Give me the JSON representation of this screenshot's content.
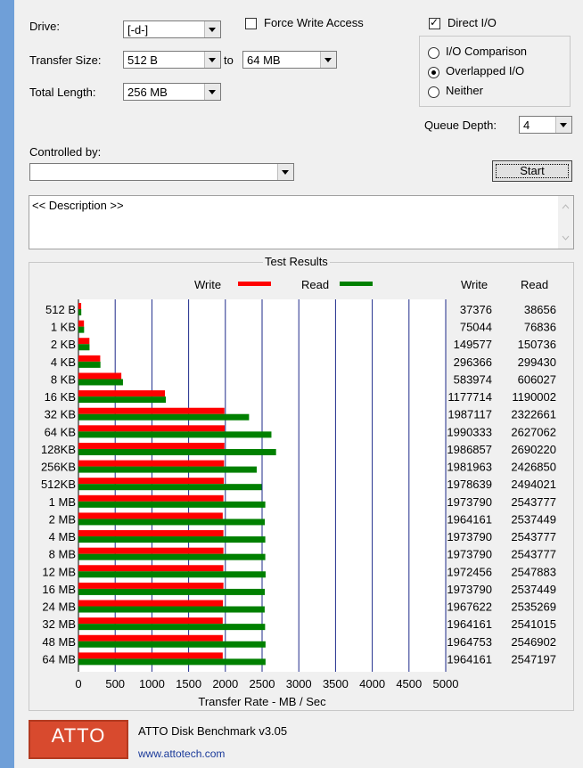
{
  "settings": {
    "drive_label": "Drive:",
    "drive_value": "[-d-]",
    "transfer_size_label": "Transfer Size:",
    "transfer_from": "512 B",
    "to_label": "to",
    "transfer_to": "64 MB",
    "total_length_label": "Total Length:",
    "total_length": "256 MB",
    "force_write_label": "Force Write Access",
    "force_write_checked": false,
    "direct_io_label": "Direct I/O",
    "direct_io_checked": true,
    "io_comparison_label": "I/O Comparison",
    "overlapped_label": "Overlapped I/O",
    "neither_label": "Neither",
    "selected_mode": "Overlapped I/O",
    "queue_depth_label": "Queue Depth:",
    "queue_depth": "4",
    "controlled_by_label": "Controlled by:",
    "controlled_by_value": "",
    "start_label": "Start",
    "description": "<< Description >>"
  },
  "results": {
    "title": "Test Results",
    "legend_write": "Write",
    "legend_read": "Read",
    "col_write": "Write",
    "col_read": "Read"
  },
  "footer": {
    "logo_text": "ATTO",
    "product": "ATTO Disk Benchmark v3.05",
    "url": "www.attotech.com"
  },
  "chart_data": {
    "type": "bar",
    "orientation": "horizontal",
    "categories": [
      "512 B",
      "1 KB",
      "2 KB",
      "4 KB",
      "8 KB",
      "16 KB",
      "32 KB",
      "64 KB",
      "128KB",
      "256KB",
      "512KB",
      "1 MB",
      "2 MB",
      "4 MB",
      "8 MB",
      "12 MB",
      "16 MB",
      "24 MB",
      "32 MB",
      "48 MB",
      "64 MB"
    ],
    "series": [
      {
        "name": "Write",
        "color": "#ff0000",
        "values": [
          37376,
          75044,
          149577,
          296366,
          583974,
          1177714,
          1987117,
          1990333,
          1986857,
          1981963,
          1978639,
          1973790,
          1964161,
          1973790,
          1973790,
          1972456,
          1973790,
          1967622,
          1964161,
          1964753,
          1964161
        ]
      },
      {
        "name": "Read",
        "color": "#008000",
        "values": [
          38656,
          76836,
          150736,
          299430,
          606027,
          1190002,
          2322661,
          2627062,
          2690220,
          2426850,
          2494021,
          2543777,
          2537449,
          2543777,
          2543777,
          2547883,
          2537449,
          2535269,
          2541015,
          2546902,
          2547197
        ]
      }
    ],
    "xlabel": "Transfer Rate - MB / Sec",
    "xticks": [
      0,
      500,
      1000,
      1500,
      2000,
      2500,
      3000,
      3500,
      4000,
      4500,
      5000
    ],
    "xlim": [
      0,
      5000
    ],
    "value_scale": 0.001,
    "grid": true
  }
}
